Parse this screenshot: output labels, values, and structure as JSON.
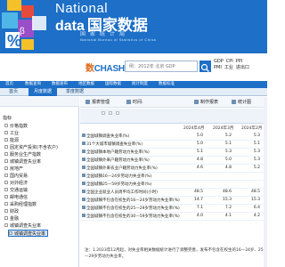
{
  "brand": {
    "en_line1": "National",
    "en_line2": "data",
    "cn": "国家数据",
    "sub_cn": "国家统计局",
    "sub_en": "National Bureau of Statistics of China"
  },
  "search": {
    "logo_a": "数",
    "logo_b": "CHASHU",
    "placeholder": "例：2012年 北京 GDP"
  },
  "quick_links": [
    "GDP",
    "CPI",
    "PPI",
    "PMI",
    "工业",
    "进出口"
  ],
  "nav": [
    "首页",
    "数据查询",
    "数据发布",
    "地区数据",
    "国际数据",
    "统计制度",
    "数据标准"
  ],
  "tabs": {
    "home": "首页",
    "active": "月度数据",
    "plain": "季度数据"
  },
  "sidebar": {
    "title": "指标",
    "items": [
      "价格指数",
      "工业",
      "能源",
      "固定资产投资(不含农户)",
      "服务业生产指数",
      "城镇调查失业率",
      "房地产",
      "国内贸易",
      "对外经济",
      "交通运输",
      "邮电通信",
      "采购经理指数",
      "财政",
      "金融",
      "城镇调查失业率"
    ],
    "selected": "城镇调查失业率"
  },
  "toolbar": {
    "items": [
      "报表管理",
      "时间:",
      "制作报表",
      "统计图"
    ]
  },
  "table": {
    "headers": [
      "2024年4月",
      "2024年3月",
      "2024年2月"
    ],
    "rows": [
      {
        "label": "全国城镇调查失业率(%)",
        "values": [
          "5.0",
          "5.2",
          "5.3"
        ]
      },
      {
        "label": "31个大城市城镇调查失业率(%)",
        "values": [
          "5.0",
          "5.1",
          "5.1"
        ]
      },
      {
        "label": "全国城镇本地户籍劳动力失业率(%)",
        "values": [
          "5.1",
          "5.3",
          "5.3"
        ]
      },
      {
        "label": "全国城镇外来户籍劳动力失业率(%)",
        "values": [
          "4.8",
          "5.0",
          "5.3"
        ]
      },
      {
        "label": "全国城镇外来农业户籍劳动力失业率(%)",
        "values": [
          "4.6",
          "4.8",
          "5.2"
        ]
      },
      {
        "label": "全国城镇16—24岁劳动力失业率(%)",
        "values": [
          "",
          "",
          ""
        ]
      },
      {
        "label": "全国城镇25—59岁劳动力失业率(%)",
        "values": [
          "",
          "",
          ""
        ]
      },
      {
        "label": "全国企业就业人员周平均工作时间(小时)",
        "values": [
          "48.5",
          "48.6",
          "48.5"
        ]
      },
      {
        "label": "全国城镇不包含在校生的16—24岁劳动力失业率(%)",
        "values": [
          "14.7",
          "15.3",
          "15.3"
        ]
      },
      {
        "label": "全国城镇不包含在校生的25—29岁劳动力失业率(%)",
        "values": [
          "7.1",
          "7.2",
          "6.4"
        ]
      },
      {
        "label": "全国城镇不包含在校生的30—59岁劳动力失业率(%)",
        "values": [
          "4.0",
          "4.1",
          "4.2"
        ]
      }
    ]
  },
  "note": "注：1.2023年12月起，对失业率相关数据统计进行了调整完善，发布不包含在校生的16—24岁、25—29岁劳动力失业率。"
}
